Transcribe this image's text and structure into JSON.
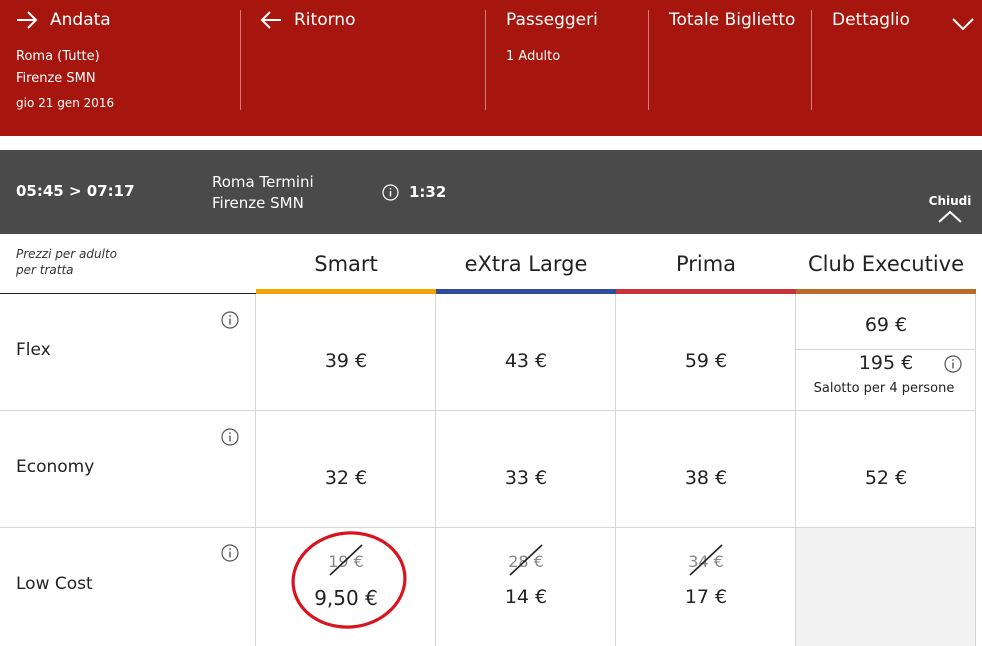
{
  "header": {
    "andata": {
      "title": "Andata",
      "origin": "Roma (Tutte)",
      "destination": "Firenze SMN",
      "date": "gio 21 gen 2016"
    },
    "ritorno": {
      "title": "Ritorno"
    },
    "passeggeri": {
      "title": "Passeggeri",
      "value": "1 Adulto"
    },
    "totale": {
      "title": "Totale Biglietto"
    },
    "dettaglio": {
      "title": "Dettaglio"
    }
  },
  "train": {
    "times": "05:45 > 07:17",
    "from": "Roma Termini",
    "to": "Firenze SMN",
    "duration": "1:32",
    "close_label": "Chiudi"
  },
  "table": {
    "note_line1": "Prezzi per adulto",
    "note_line2": "per tratta",
    "columns": [
      {
        "label": "Smart",
        "color": "#f2a500"
      },
      {
        "label": "eXtra Large",
        "color": "#2f4e9a"
      },
      {
        "label": "Prima",
        "color": "#c8323a"
      },
      {
        "label": "Club Executive",
        "color": "#b86a2a"
      }
    ],
    "rows": [
      {
        "label": "Flex",
        "prices": [
          "39 €",
          "43 €",
          "59 €"
        ],
        "club": {
          "price1": "69 €",
          "price2": "195 €",
          "note": "Salotto per 4 persone"
        }
      },
      {
        "label": "Economy",
        "prices": [
          "32 €",
          "33 €",
          "38 €"
        ],
        "club_price": "52 €"
      },
      {
        "label": "Low Cost",
        "old_prices": [
          "19 €",
          "28 €",
          "34 €"
        ],
        "prices": [
          "9,50 €",
          "14 €",
          "17 €"
        ]
      }
    ]
  },
  "colors": {
    "header_red": "#a6160e",
    "train_bar": "#4a4a4a",
    "circle_red": "#d9141e"
  }
}
